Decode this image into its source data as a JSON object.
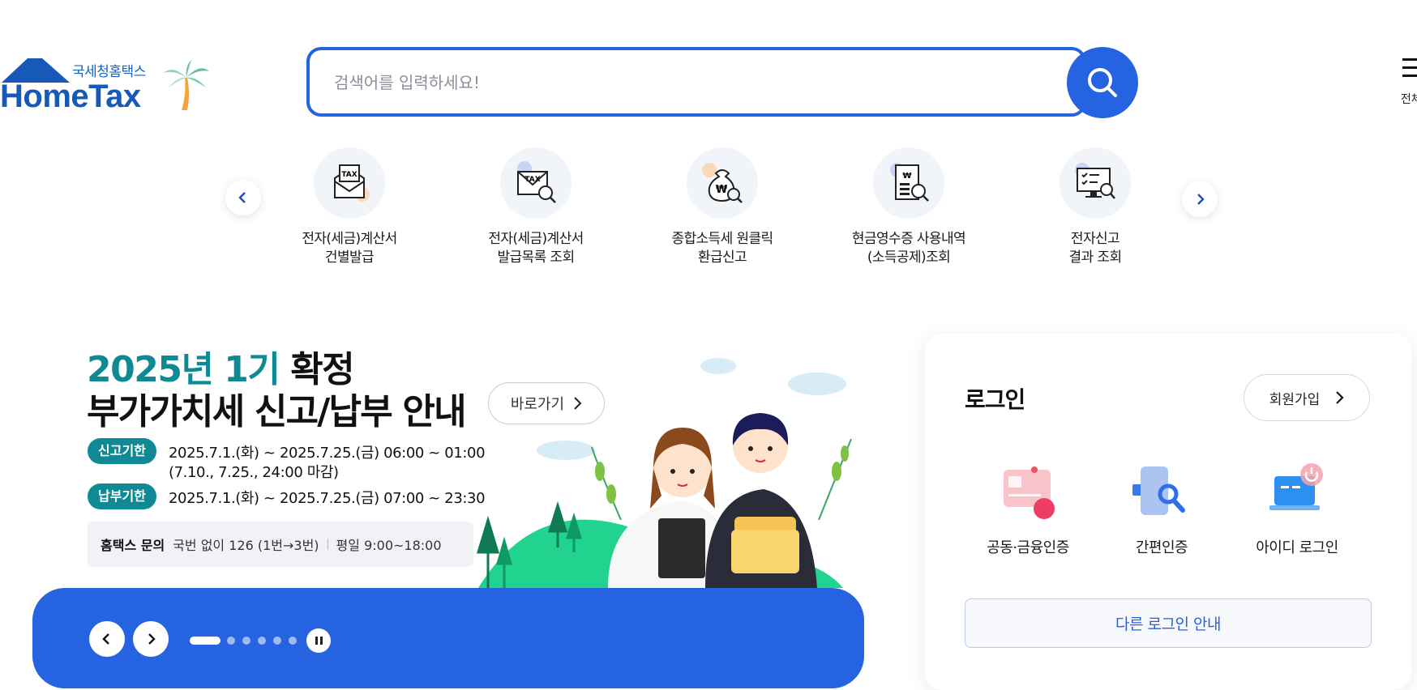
{
  "header": {
    "logo_subtitle": "국세청홈택스",
    "logo_text": "HomeTax",
    "search_placeholder": "검색어를 입력하세요!",
    "right_menu_label": "전체"
  },
  "quick_menu": {
    "items": [
      {
        "line1": "전자(세금)계산서",
        "line2": "건별발급",
        "icon": "tax-envelope-icon"
      },
      {
        "line1": "전자(세금)계산서",
        "line2": "발급목록 조회",
        "icon": "tax-document-search-icon"
      },
      {
        "line1": "종합소득세 원클릭",
        "line2": "환급신고",
        "icon": "money-bag-search-icon"
      },
      {
        "line1": "현금영수증 사용내역",
        "line2": "(소득공제)조회",
        "icon": "receipt-search-icon"
      },
      {
        "line1": "전자신고",
        "line2": "결과 조회",
        "icon": "monitor-search-icon"
      }
    ]
  },
  "banner": {
    "title_year": "2025년 1기",
    "title_confirm": "확정",
    "title_line2": "부가가치세 신고/납부 안내",
    "goto_label": "바로가기",
    "filing_pill": "신고기한",
    "filing_period": "2025.7.1.(화) ~ 2025.7.25.(금) 06:00 ~ 01:00",
    "filing_note": "(7.10., 7.25., 24:00 마감)",
    "payment_pill": "납부기한",
    "payment_period": "2025.7.1.(화) ~ 2025.7.25.(금) 07:00 ~ 23:30",
    "inquiry_label": "홈택스 문의",
    "inquiry_phone": "국번 없이 126 (1번→3번)",
    "inquiry_hours": "평일 9:00~18:00",
    "slide_count": 6,
    "active_slide": 1
  },
  "login": {
    "title": "로그인",
    "signup_label": "회원가입",
    "options": [
      {
        "label": "공동·금융인증",
        "icon": "certificate-card-icon"
      },
      {
        "label": "간편인증",
        "icon": "simple-auth-icon"
      },
      {
        "label": "아이디 로그인",
        "icon": "id-login-laptop-icon"
      }
    ],
    "other_login_label": "다른 로그인 안내"
  },
  "colors": {
    "primary": "#2563e0",
    "teal": "#0f8a94",
    "logo_blue": "#1759b8"
  }
}
